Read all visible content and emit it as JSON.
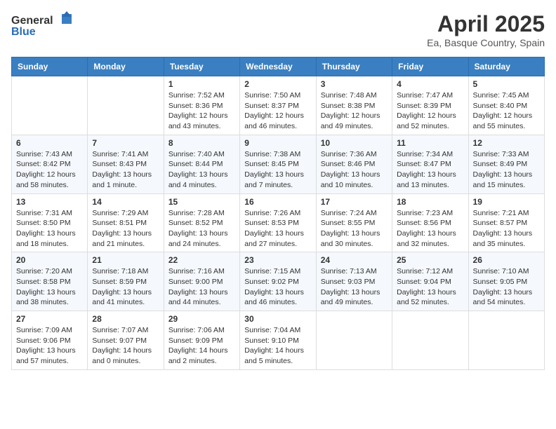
{
  "header": {
    "logo_general": "General",
    "logo_blue": "Blue",
    "month_title": "April 2025",
    "location": "Ea, Basque Country, Spain"
  },
  "days_of_week": [
    "Sunday",
    "Monday",
    "Tuesday",
    "Wednesday",
    "Thursday",
    "Friday",
    "Saturday"
  ],
  "weeks": [
    [
      {
        "day": "",
        "info": ""
      },
      {
        "day": "",
        "info": ""
      },
      {
        "day": "1",
        "info": "Sunrise: 7:52 AM\nSunset: 8:36 PM\nDaylight: 12 hours and 43 minutes."
      },
      {
        "day": "2",
        "info": "Sunrise: 7:50 AM\nSunset: 8:37 PM\nDaylight: 12 hours and 46 minutes."
      },
      {
        "day": "3",
        "info": "Sunrise: 7:48 AM\nSunset: 8:38 PM\nDaylight: 12 hours and 49 minutes."
      },
      {
        "day": "4",
        "info": "Sunrise: 7:47 AM\nSunset: 8:39 PM\nDaylight: 12 hours and 52 minutes."
      },
      {
        "day": "5",
        "info": "Sunrise: 7:45 AM\nSunset: 8:40 PM\nDaylight: 12 hours and 55 minutes."
      }
    ],
    [
      {
        "day": "6",
        "info": "Sunrise: 7:43 AM\nSunset: 8:42 PM\nDaylight: 12 hours and 58 minutes."
      },
      {
        "day": "7",
        "info": "Sunrise: 7:41 AM\nSunset: 8:43 PM\nDaylight: 13 hours and 1 minute."
      },
      {
        "day": "8",
        "info": "Sunrise: 7:40 AM\nSunset: 8:44 PM\nDaylight: 13 hours and 4 minutes."
      },
      {
        "day": "9",
        "info": "Sunrise: 7:38 AM\nSunset: 8:45 PM\nDaylight: 13 hours and 7 minutes."
      },
      {
        "day": "10",
        "info": "Sunrise: 7:36 AM\nSunset: 8:46 PM\nDaylight: 13 hours and 10 minutes."
      },
      {
        "day": "11",
        "info": "Sunrise: 7:34 AM\nSunset: 8:47 PM\nDaylight: 13 hours and 13 minutes."
      },
      {
        "day": "12",
        "info": "Sunrise: 7:33 AM\nSunset: 8:49 PM\nDaylight: 13 hours and 15 minutes."
      }
    ],
    [
      {
        "day": "13",
        "info": "Sunrise: 7:31 AM\nSunset: 8:50 PM\nDaylight: 13 hours and 18 minutes."
      },
      {
        "day": "14",
        "info": "Sunrise: 7:29 AM\nSunset: 8:51 PM\nDaylight: 13 hours and 21 minutes."
      },
      {
        "day": "15",
        "info": "Sunrise: 7:28 AM\nSunset: 8:52 PM\nDaylight: 13 hours and 24 minutes."
      },
      {
        "day": "16",
        "info": "Sunrise: 7:26 AM\nSunset: 8:53 PM\nDaylight: 13 hours and 27 minutes."
      },
      {
        "day": "17",
        "info": "Sunrise: 7:24 AM\nSunset: 8:55 PM\nDaylight: 13 hours and 30 minutes."
      },
      {
        "day": "18",
        "info": "Sunrise: 7:23 AM\nSunset: 8:56 PM\nDaylight: 13 hours and 32 minutes."
      },
      {
        "day": "19",
        "info": "Sunrise: 7:21 AM\nSunset: 8:57 PM\nDaylight: 13 hours and 35 minutes."
      }
    ],
    [
      {
        "day": "20",
        "info": "Sunrise: 7:20 AM\nSunset: 8:58 PM\nDaylight: 13 hours and 38 minutes."
      },
      {
        "day": "21",
        "info": "Sunrise: 7:18 AM\nSunset: 8:59 PM\nDaylight: 13 hours and 41 minutes."
      },
      {
        "day": "22",
        "info": "Sunrise: 7:16 AM\nSunset: 9:00 PM\nDaylight: 13 hours and 44 minutes."
      },
      {
        "day": "23",
        "info": "Sunrise: 7:15 AM\nSunset: 9:02 PM\nDaylight: 13 hours and 46 minutes."
      },
      {
        "day": "24",
        "info": "Sunrise: 7:13 AM\nSunset: 9:03 PM\nDaylight: 13 hours and 49 minutes."
      },
      {
        "day": "25",
        "info": "Sunrise: 7:12 AM\nSunset: 9:04 PM\nDaylight: 13 hours and 52 minutes."
      },
      {
        "day": "26",
        "info": "Sunrise: 7:10 AM\nSunset: 9:05 PM\nDaylight: 13 hours and 54 minutes."
      }
    ],
    [
      {
        "day": "27",
        "info": "Sunrise: 7:09 AM\nSunset: 9:06 PM\nDaylight: 13 hours and 57 minutes."
      },
      {
        "day": "28",
        "info": "Sunrise: 7:07 AM\nSunset: 9:07 PM\nDaylight: 14 hours and 0 minutes."
      },
      {
        "day": "29",
        "info": "Sunrise: 7:06 AM\nSunset: 9:09 PM\nDaylight: 14 hours and 2 minutes."
      },
      {
        "day": "30",
        "info": "Sunrise: 7:04 AM\nSunset: 9:10 PM\nDaylight: 14 hours and 5 minutes."
      },
      {
        "day": "",
        "info": ""
      },
      {
        "day": "",
        "info": ""
      },
      {
        "day": "",
        "info": ""
      }
    ]
  ]
}
